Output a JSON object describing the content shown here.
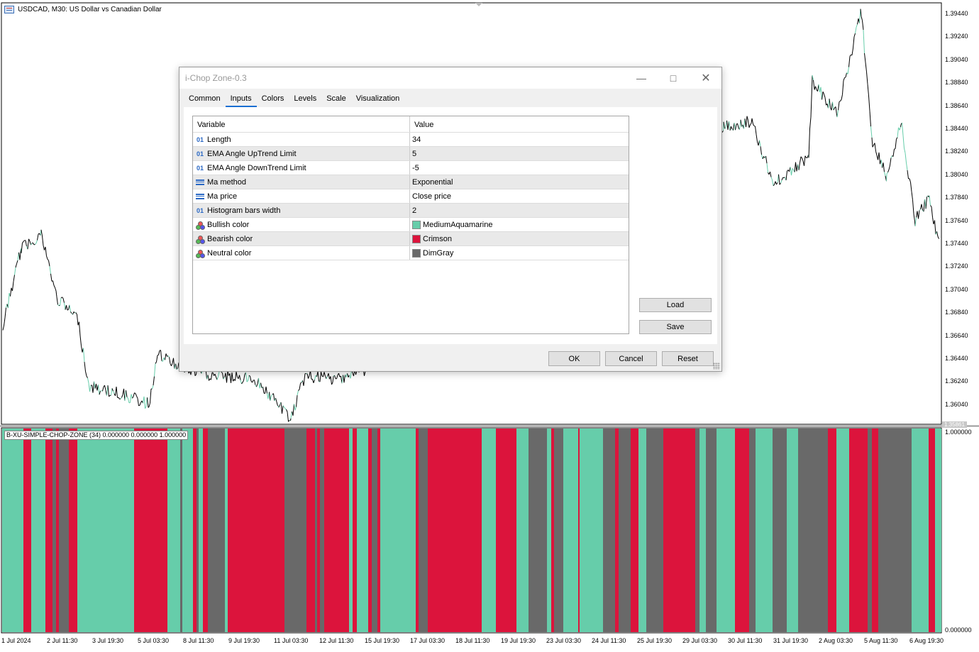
{
  "chart": {
    "symbol_title": "USDCAD, M30:  US Dollar vs Canadian Dollar",
    "price_axis": [
      "1.39440",
      "1.39240",
      "1.39040",
      "1.38840",
      "1.38640",
      "1.38440",
      "1.38240",
      "1.38040",
      "1.37840",
      "1.37640",
      "1.37440",
      "1.37240",
      "1.37040",
      "1.36840",
      "1.36640",
      "1.36440",
      "1.36240",
      "1.36040"
    ],
    "current_price": "1.35861",
    "time_axis": [
      "1 Jul 2024",
      "2 Jul 11:30",
      "3 Jul 19:30",
      "5 Jul 03:30",
      "8 Jul 11:30",
      "9 Jul 19:30",
      "11 Jul 03:30",
      "12 Jul 11:30",
      "15 Jul 19:30",
      "17 Jul 03:30",
      "18 Jul 11:30",
      "19 Jul 19:30",
      "23 Jul 03:30",
      "24 Jul 11:30",
      "25 Jul 19:30",
      "29 Jul 03:30",
      "30 Jul 11:30",
      "31 Jul 19:30",
      "2 Aug 03:30",
      "5 Aug 11:30",
      "6 Aug 19:30"
    ],
    "indicator_label": "B-XU-SIMPLE-CHOP-ZONE (34) 0.000000 0.000000 1.000000",
    "indicator_scale_top": "1.000000",
    "indicator_scale_bottom": "0.000000",
    "colors": {
      "bullish": "#66CDAA",
      "bearish": "#DC143C",
      "neutral": "#696969",
      "candle": "#000000"
    }
  },
  "dialog": {
    "title": "i-Chop Zone-0.3",
    "tabs": [
      "Common",
      "Inputs",
      "Colors",
      "Levels",
      "Scale",
      "Visualization"
    ],
    "active_tab": "Inputs",
    "grid_headers": {
      "variable": "Variable",
      "value": "Value"
    },
    "rows": [
      {
        "type": "01",
        "icon": "int-icon",
        "variable": "Length",
        "value": "34"
      },
      {
        "type": "01",
        "icon": "int-icon",
        "variable": "EMA Angle UpTrend Limit",
        "value": "5"
      },
      {
        "type": "01",
        "icon": "int-icon",
        "variable": "EMA Angle DownTrend Limit",
        "value": "-5"
      },
      {
        "type": "",
        "icon": "enum-icon",
        "variable": "Ma method",
        "value": "Exponential"
      },
      {
        "type": "",
        "icon": "enum-icon",
        "variable": "Ma price",
        "value": "Close price"
      },
      {
        "type": "01",
        "icon": "int-icon",
        "variable": "Histogram bars width",
        "value": "2"
      },
      {
        "type": "",
        "icon": "color-icon",
        "variable": "Bullish color",
        "value": "MediumAquamarine",
        "swatch": "#66CDAA"
      },
      {
        "type": "",
        "icon": "color-icon",
        "variable": "Bearish color",
        "value": "Crimson",
        "swatch": "#DC143C"
      },
      {
        "type": "",
        "icon": "color-icon",
        "variable": "Neutral color",
        "value": "DimGray",
        "swatch": "#696969"
      }
    ],
    "buttons": {
      "load": "Load",
      "save": "Save",
      "ok": "OK",
      "cancel": "Cancel",
      "reset": "Reset"
    }
  }
}
